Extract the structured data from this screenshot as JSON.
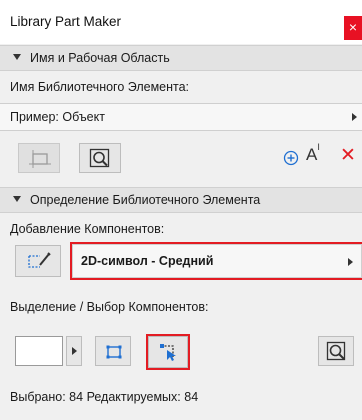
{
  "window": {
    "title": "Library Part Maker",
    "close_glyph": "×"
  },
  "section1": {
    "header": "Имя и Рабочая Область",
    "name_label": "Имя Библиотечного Элемента:",
    "name_value": "Пример: Объект",
    "icons": [
      "work-area-icon",
      "zoom-fit-icon",
      "add-icon",
      "text-size-icon",
      "delete-icon"
    ],
    "text_size_glyph": "A",
    "text_size_sup": "I",
    "delete_glyph": "✕",
    "add_glyph": "⊕"
  },
  "section2": {
    "header": "Определение Библиотечного Элемента",
    "add_label": "Добавление Компонентов:",
    "component_value": "2D-символ - Средний",
    "select_label": "Выделение / Выбор Компонентов:",
    "status": "Выбрано: 84 Редактируемых: 84"
  },
  "colors": {
    "accent_red": "#e31c23",
    "blue_icon": "#1f6fd1",
    "close_bg": "#e81123"
  }
}
